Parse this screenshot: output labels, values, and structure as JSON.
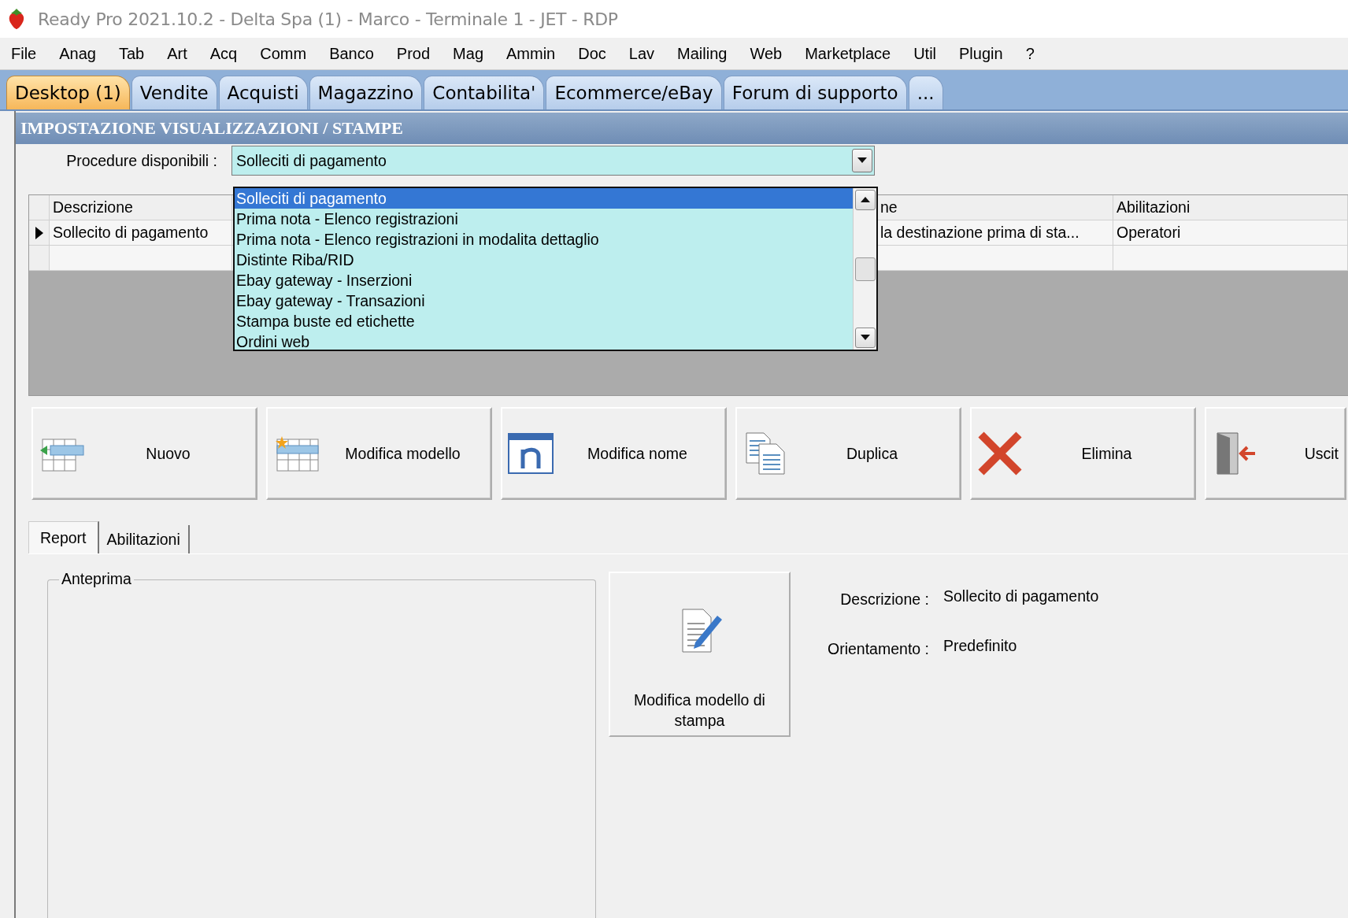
{
  "window": {
    "title": "Ready Pro 2021.10.2 - Delta Spa (1) - Marco - Terminale 1 - JET - RDP"
  },
  "menu": [
    "File",
    "Anag",
    "Tab",
    "Art",
    "Acq",
    "Comm",
    "Banco",
    "Prod",
    "Mag",
    "Ammin",
    "Doc",
    "Lav",
    "Mailing",
    "Web",
    "Marketplace",
    "Util",
    "Plugin",
    "?"
  ],
  "tabs": [
    {
      "label": "Desktop (1)",
      "selected": true
    },
    {
      "label": "Vendite",
      "selected": false
    },
    {
      "label": "Acquisti",
      "selected": false
    },
    {
      "label": "Magazzino",
      "selected": false
    },
    {
      "label": "Contabilita'",
      "selected": false
    },
    {
      "label": "Ecommerce/eBay",
      "selected": false
    },
    {
      "label": "Forum di supporto",
      "selected": false
    },
    {
      "label": "...",
      "selected": false
    }
  ],
  "panel": {
    "title": "IMPOSTAZIONE VISUALIZZAZIONI / STAMPE"
  },
  "procedure": {
    "label": "Procedure disponibili :",
    "value": "Solleciti di pagamento",
    "options": [
      {
        "label": "Solleciti di pagamento",
        "selected": true
      },
      {
        "label": "Prima nota - Elenco registrazioni",
        "selected": false
      },
      {
        "label": "Prima nota - Elenco registrazioni in modalita dettaglio",
        "selected": false
      },
      {
        "label": "Distinte Riba/RID",
        "selected": false
      },
      {
        "label": "Ebay gateway - Inserzioni",
        "selected": false
      },
      {
        "label": "Ebay gateway - Transazioni",
        "selected": false
      },
      {
        "label": "Stampa buste ed etichette",
        "selected": false
      },
      {
        "label": "Ordini web",
        "selected": false
      }
    ]
  },
  "grid": {
    "columns": [
      "Descrizione",
      "ne",
      "Abilitazioni"
    ],
    "rows": [
      {
        "selected": true,
        "cells": [
          "Sollecito di pagamento",
          "la destinazione prima di sta...",
          "Operatori"
        ]
      }
    ]
  },
  "toolbar": [
    {
      "label": "Nuovo",
      "kind": "new"
    },
    {
      "label": "Modifica modello",
      "kind": "model"
    },
    {
      "label": "Modifica nome",
      "kind": "rename"
    },
    {
      "label": "Duplica",
      "kind": "duplicate"
    },
    {
      "label": "Elimina",
      "kind": "delete"
    },
    {
      "label": "Uscit",
      "kind": "exit"
    }
  ],
  "detail_tabs": [
    {
      "label": "Report",
      "selected": true
    },
    {
      "label": "Abilitazioni",
      "selected": false
    }
  ],
  "preview": {
    "title": "Anteprima"
  },
  "edit_button": {
    "label": "Modifica modello di stampa"
  },
  "fields": [
    {
      "label": "Descrizione :",
      "value": "Sollecito di pagamento"
    },
    {
      "label": "Orientamento :",
      "value": "Predefinito"
    }
  ]
}
